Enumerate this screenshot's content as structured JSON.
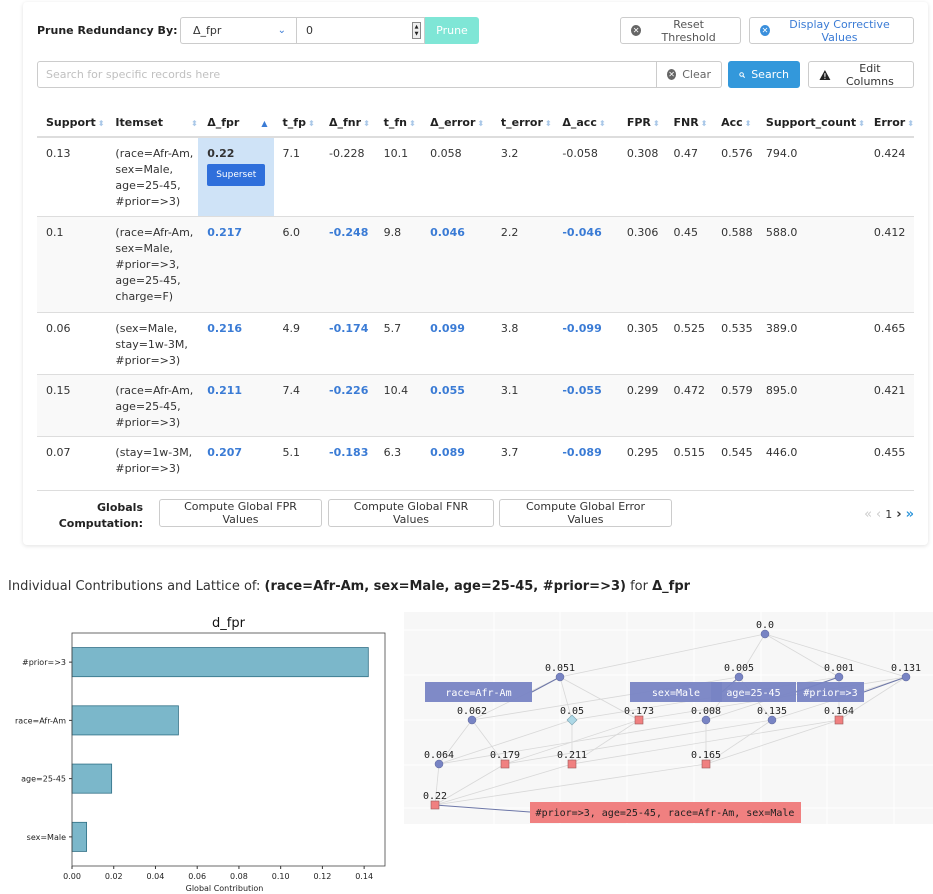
{
  "toolbar": {
    "prune_label": "Prune Redundancy By:",
    "metric_selected": "Δ_fpr",
    "threshold_value": "0",
    "prune_button": "Prune",
    "reset_button": "Reset Threshold",
    "corrective_button": "Display Corrective Values",
    "accent_color": "#3398db",
    "prune_color": "#7fe6d6"
  },
  "search": {
    "placeholder": "Search for specific records here",
    "value": "",
    "clear_button": "Clear",
    "search_button": "Search",
    "edit_columns_button": "Edit Columns"
  },
  "table": {
    "columns": [
      "Support",
      "Itemset",
      "Δ_fpr",
      "t_fp",
      "Δ_fnr",
      "t_fn",
      "Δ_error",
      "t_error",
      "Δ_acc",
      "FPR",
      "FNR",
      "Acc",
      "Support_count",
      "Error"
    ],
    "sorted_column": "Δ_fpr",
    "sort_direction": "ascending-indicator",
    "rows": [
      {
        "support": "0.13",
        "itemset": [
          "(race=Afr-Am,",
          "sex=Male,",
          "age=25-45,",
          "#prior=>3)"
        ],
        "d_fpr": "0.22",
        "t_fp": "7.1",
        "d_fnr": "-0.228",
        "t_fn": "10.1",
        "d_error": "0.058",
        "t_error": "3.2",
        "d_acc": "-0.058",
        "fpr": "0.308",
        "fnr": "0.47",
        "acc": "0.576",
        "support_count": "794.0",
        "error": "0.424",
        "badge": "Superset"
      },
      {
        "support": "0.1",
        "itemset": [
          "(race=Afr-Am,",
          "sex=Male,",
          "#prior=>3,",
          "age=25-45,",
          "charge=F)"
        ],
        "d_fpr": "0.217",
        "t_fp": "6.0",
        "d_fnr": "-0.248",
        "t_fn": "9.8",
        "d_error": "0.046",
        "t_error": "2.2",
        "d_acc": "-0.046",
        "fpr": "0.306",
        "fnr": "0.45",
        "acc": "0.588",
        "support_count": "588.0",
        "error": "0.412"
      },
      {
        "support": "0.06",
        "itemset": [
          "(sex=Male,",
          "stay=1w-3M,",
          "#prior=>3)"
        ],
        "d_fpr": "0.216",
        "t_fp": "4.9",
        "d_fnr": "-0.174",
        "t_fn": "5.7",
        "d_error": "0.099",
        "t_error": "3.8",
        "d_acc": "-0.099",
        "fpr": "0.305",
        "fnr": "0.525",
        "acc": "0.535",
        "support_count": "389.0",
        "error": "0.465"
      },
      {
        "support": "0.15",
        "itemset": [
          "(race=Afr-Am,",
          "age=25-45,",
          "#prior=>3)"
        ],
        "d_fpr": "0.211",
        "t_fp": "7.4",
        "d_fnr": "-0.226",
        "t_fn": "10.4",
        "d_error": "0.055",
        "t_error": "3.1",
        "d_acc": "-0.055",
        "fpr": "0.299",
        "fnr": "0.472",
        "acc": "0.579",
        "support_count": "895.0",
        "error": "0.421"
      },
      {
        "support": "0.07",
        "itemset": [
          "(stay=1w-3M,",
          "#prior=>3)"
        ],
        "d_fpr": "0.207",
        "t_fp": "5.1",
        "d_fnr": "-0.183",
        "t_fn": "6.3",
        "d_error": "0.089",
        "t_error": "3.7",
        "d_acc": "-0.089",
        "fpr": "0.295",
        "fnr": "0.515",
        "acc": "0.545",
        "support_count": "446.0",
        "error": "0.455"
      }
    ]
  },
  "globals": {
    "label_line1": "Globals",
    "label_line2": "Computation:",
    "buttons": [
      "Compute Global FPR Values",
      "Compute Global FNR Values",
      "Compute Global Error Values"
    ]
  },
  "pagination": {
    "first": "«",
    "prev": "‹",
    "current": "1",
    "next": "›",
    "last": "»"
  },
  "section": {
    "prefix": "Individual Contributions and Lattice of: ",
    "itemset": "(race=Afr-Am, sex=Male, age=25-45, #prior=>3)",
    "mid": " for ",
    "metric": "Δ_fpr"
  },
  "chart_data": [
    {
      "type": "bar",
      "orientation": "horizontal",
      "title": "d_fpr",
      "xlabel": "Global Contribution",
      "ylabel": "",
      "categories": [
        "#prior=>3",
        "race=Afr-Am",
        "age=25-45",
        "sex=Male"
      ],
      "values": [
        0.142,
        0.051,
        0.019,
        0.007
      ],
      "xlim": [
        0.0,
        0.15
      ],
      "xticks": [
        "0.00",
        "0.02",
        "0.04",
        "0.06",
        "0.08",
        "0.10",
        "0.12",
        "0.14"
      ],
      "bar_color": "#7bb7ca",
      "grid": false
    },
    {
      "type": "lattice",
      "nodes": [
        {
          "id": "root",
          "value": "0.0",
          "level": 0,
          "shape": "circle"
        },
        {
          "id": "race",
          "value": "0.051",
          "level": 1,
          "shape": "circle",
          "label": "race=Afr-Am"
        },
        {
          "id": "sex",
          "value": "0.005",
          "level": 1,
          "shape": "circle",
          "label": "sex=Male"
        },
        {
          "id": "age",
          "value": "0.001",
          "level": 1,
          "shape": "circle",
          "label": "age=25-45"
        },
        {
          "id": "prior",
          "value": "0.131",
          "level": 1,
          "shape": "circle",
          "label": "#prior=>3"
        },
        {
          "id": "race_sex",
          "value": "0.062",
          "level": 2,
          "shape": "circle"
        },
        {
          "id": "race_age",
          "value": "0.05",
          "level": 2,
          "shape": "diamond"
        },
        {
          "id": "race_prior",
          "value": "0.173",
          "level": 2,
          "shape": "square"
        },
        {
          "id": "sex_age",
          "value": "0.008",
          "level": 2,
          "shape": "circle"
        },
        {
          "id": "sex_prior",
          "value": "0.135",
          "level": 2,
          "shape": "circle"
        },
        {
          "id": "age_prior",
          "value": "0.164",
          "level": 2,
          "shape": "square"
        },
        {
          "id": "race_sex_age",
          "value": "0.064",
          "level": 3,
          "shape": "circle"
        },
        {
          "id": "race_sex_prior",
          "value": "0.179",
          "level": 3,
          "shape": "square"
        },
        {
          "id": "race_age_prior",
          "value": "0.211",
          "level": 3,
          "shape": "square"
        },
        {
          "id": "sex_age_prior",
          "value": "0.165",
          "level": 3,
          "shape": "square"
        },
        {
          "id": "all",
          "value": "0.22",
          "level": 4,
          "shape": "square",
          "label": "#prior=>3, age=25-45, race=Afr-Am, sex=Male"
        }
      ],
      "colors": {
        "circle": "#7884c4",
        "square": "#f08080",
        "diamond": "#add8e6",
        "label_box": "#7884c4",
        "highlight_box": "#f08080"
      }
    }
  ]
}
